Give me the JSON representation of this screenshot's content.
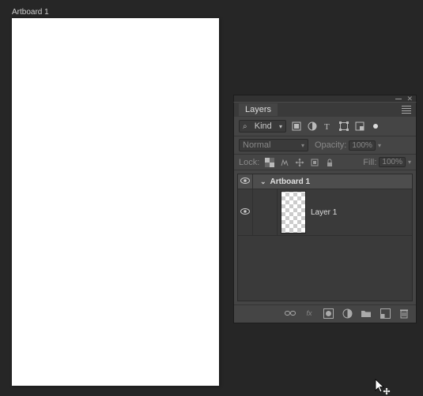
{
  "canvas": {
    "artboard_label": "Artboard 1"
  },
  "panel": {
    "title": "Layers",
    "filter": {
      "label": "Kind"
    },
    "blend": {
      "mode": "Normal",
      "opacity_label": "Opacity:",
      "opacity_value": "100%"
    },
    "lock": {
      "label": "Lock:",
      "fill_label": "Fill:",
      "fill_value": "100%"
    },
    "tree": {
      "artboard_name": "Artboard 1",
      "layers": [
        {
          "name": "Layer 1"
        }
      ]
    },
    "footer": {
      "fx": "fx"
    }
  }
}
